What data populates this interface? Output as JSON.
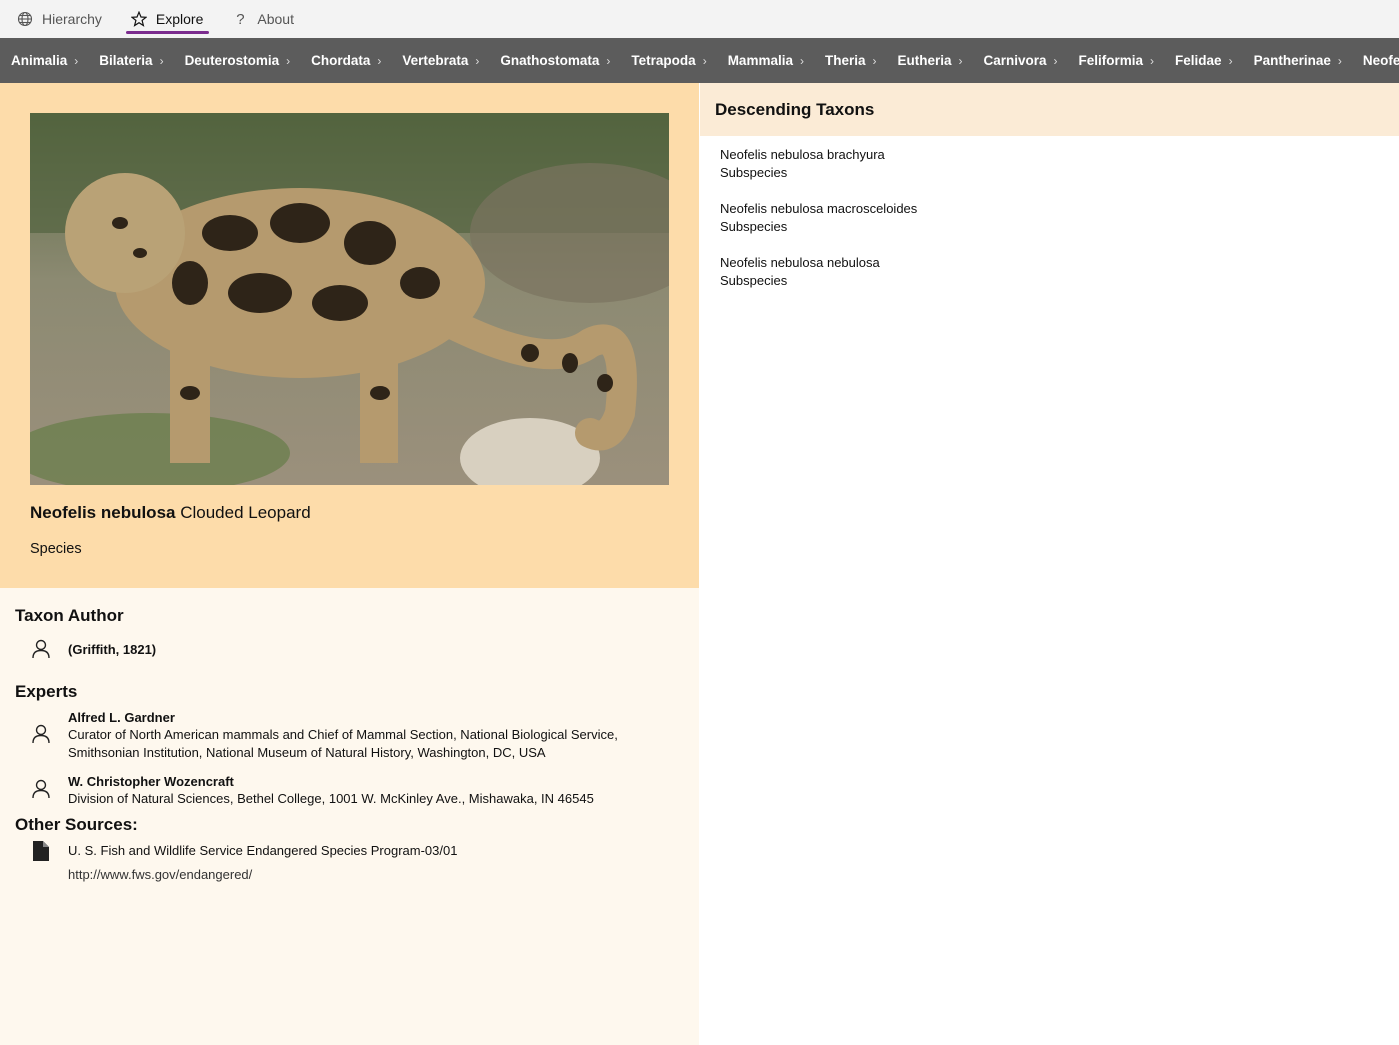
{
  "nav": {
    "tabs": [
      {
        "label": "Hierarchy",
        "icon": "globe-icon"
      },
      {
        "label": "Explore",
        "icon": "star-icon",
        "active": true
      },
      {
        "label": "About",
        "icon": "question-icon"
      }
    ]
  },
  "breadcrumb": [
    "Animalia",
    "Bilateria",
    "Deuterostomia",
    "Chordata",
    "Vertebrata",
    "Gnathostomata",
    "Tetrapoda",
    "Mammalia",
    "Theria",
    "Eutheria",
    "Carnivora",
    "Feliformia",
    "Felidae",
    "Pantherinae",
    "Neofelis"
  ],
  "species": {
    "scientific_name": "Neofelis nebulosa",
    "common_name": "Clouded Leopard",
    "rank": "Species"
  },
  "taxon_author": {
    "heading": "Taxon Author",
    "name": "(Griffith, 1821)"
  },
  "experts": {
    "heading": "Experts",
    "items": [
      {
        "name": "Alfred L. Gardner",
        "line1": "Curator of North American mammals and Chief of Mammal Section, National Biological Service,",
        "line2": "Smithsonian Institution, National Museum of Natural History, Washington, DC, USA"
      },
      {
        "name": "W. Christopher Wozencraft",
        "line1": "Division of Natural Sciences, Bethel College, 1001 W. McKinley Ave., Mishawaka, IN 46545"
      }
    ]
  },
  "other_sources": {
    "heading": "Other Sources:",
    "title": "U. S. Fish and Wildlife Service Endangered Species Program-03/01",
    "url": "http://www.fws.gov/endangered/"
  },
  "descending": {
    "heading": "Descending Taxons",
    "items": [
      {
        "name": "Neofelis nebulosa brachyura",
        "rank": "Subspecies"
      },
      {
        "name": "Neofelis nebulosa macrosceloides",
        "rank": "Subspecies"
      },
      {
        "name": "Neofelis nebulosa nebulosa",
        "rank": "Subspecies"
      }
    ]
  },
  "colors": {
    "accent": "#7b2c8e",
    "breadcrumb_bg": "#5c5c5c",
    "hero_bg": "#fddcaa",
    "details_bg": "#fef8ee",
    "right_header_bg": "#fbebd6"
  }
}
